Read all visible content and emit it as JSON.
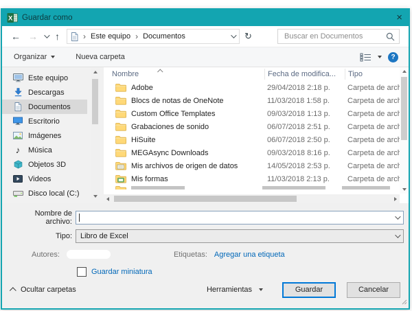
{
  "window": {
    "title": "Guardar como",
    "close_glyph": "×"
  },
  "navbar": {
    "back_glyph": "←",
    "forward_glyph": "→",
    "up_glyph": "↑",
    "refresh_glyph": "↻",
    "breadcrumb": {
      "separator": "›",
      "items": [
        "Este equipo",
        "Documentos"
      ]
    },
    "search_placeholder": "Buscar en Documentos"
  },
  "toolbar": {
    "organize_label": "Organizar",
    "new_folder_label": "Nueva carpeta",
    "help_glyph": "?"
  },
  "sidebar": {
    "items": [
      {
        "label": "Este equipo",
        "selected": false
      },
      {
        "label": "Descargas",
        "selected": false
      },
      {
        "label": "Documentos",
        "selected": true
      },
      {
        "label": "Escritorio",
        "selected": false
      },
      {
        "label": "Imágenes",
        "selected": false
      },
      {
        "label": "Música",
        "selected": false
      },
      {
        "label": "Objetos 3D",
        "selected": false
      },
      {
        "label": "Videos",
        "selected": false
      },
      {
        "label": "Disco local (C:)",
        "selected": false
      }
    ]
  },
  "filelist": {
    "columns": [
      "Nombre",
      "Fecha de modifica...",
      "Tipo"
    ],
    "rows": [
      {
        "name": "Adobe",
        "date": "29/04/2018 2:18 p.",
        "type": "Carpeta de archiv"
      },
      {
        "name": "Blocs de notas de OneNote",
        "date": "11/03/2018 1:58 p.",
        "type": "Carpeta de archiv"
      },
      {
        "name": "Custom Office Templates",
        "date": "09/03/2018 1:13 p.",
        "type": "Carpeta de archiv"
      },
      {
        "name": "Grabaciones de sonido",
        "date": "06/07/2018 2:51 p.",
        "type": "Carpeta de archiv"
      },
      {
        "name": "HiSuite",
        "date": "06/07/2018 2:50 p.",
        "type": "Carpeta de archiv"
      },
      {
        "name": "MEGAsync Downloads",
        "date": "09/03/2018 8:16 p.",
        "type": "Carpeta de archiv"
      },
      {
        "name": "Mis archivos de origen de datos",
        "date": "14/05/2018 2:53 p.",
        "type": "Carpeta de archiv"
      },
      {
        "name": "Mis formas",
        "date": "11/03/2018 2:13 p.",
        "type": "Carpeta de archiv"
      }
    ]
  },
  "fields": {
    "filename_label": "Nombre de archivo:",
    "filename_value": "",
    "type_label": "Tipo:",
    "type_value": "Libro de Excel",
    "authors_label": "Autores:",
    "tags_label": "Etiquetas:",
    "tags_link": "Agregar una etiqueta",
    "thumbnail_label": "Guardar miniatura"
  },
  "footer": {
    "hide_folders_label": "Ocultar carpetas",
    "tools_label": "Herramientas",
    "save_label": "Guardar",
    "cancel_label": "Cancelar"
  },
  "colors": {
    "titlebar_accent": "#13a5b1",
    "selection_gray": "#d9d9d9",
    "link_blue": "#0067b8",
    "save_button_border": "#0078d7",
    "folder_yellow": "#ffd978"
  }
}
